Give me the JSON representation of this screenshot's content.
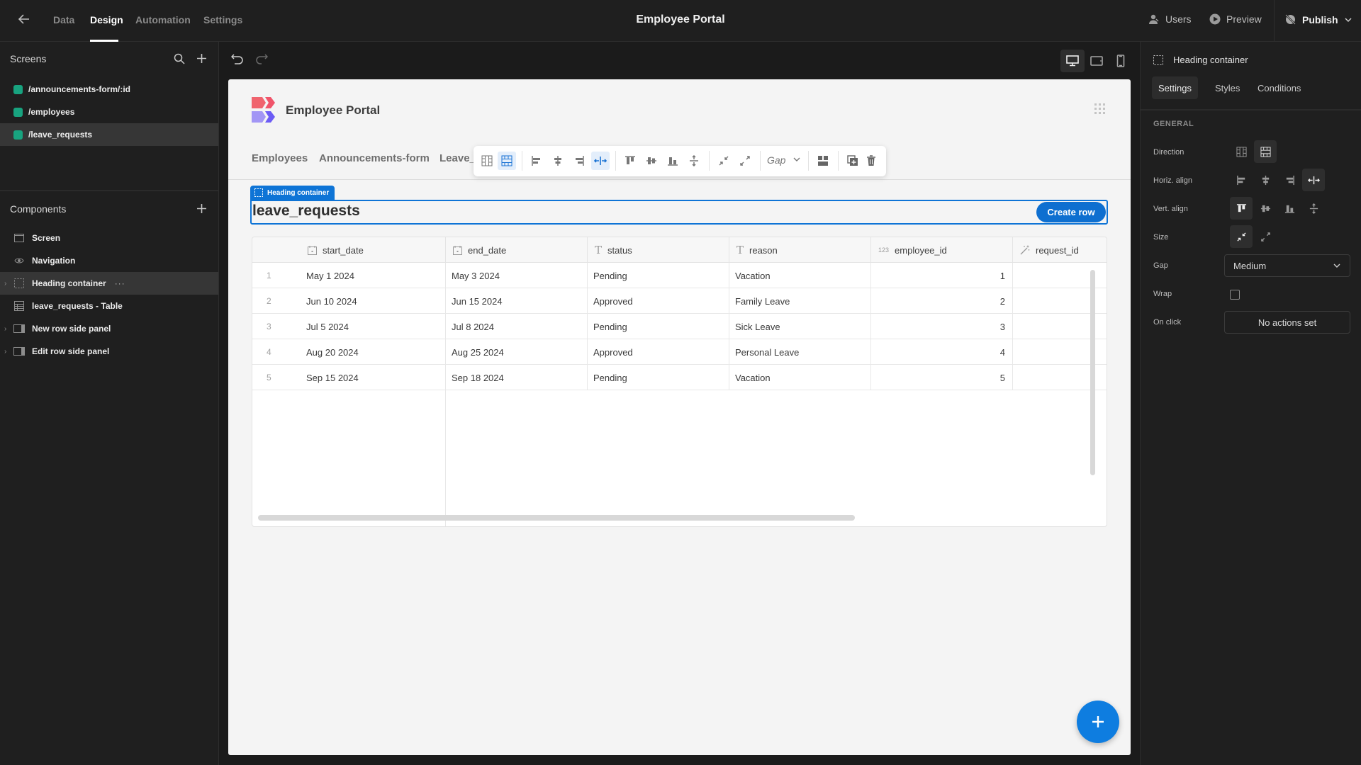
{
  "topbar": {
    "back_icon": "arrow-left-icon",
    "tabs": [
      {
        "label": "Data",
        "active": false
      },
      {
        "label": "Design",
        "active": true
      },
      {
        "label": "Automation",
        "active": false
      },
      {
        "label": "Settings",
        "active": false
      }
    ],
    "title": "Employee Portal",
    "users_label": "Users",
    "preview_label": "Preview",
    "publish_label": "Publish"
  },
  "sidebar": {
    "screens_title": "Screens",
    "screens": [
      {
        "label": "/announcements-form/:id",
        "selected": false
      },
      {
        "label": "/employees",
        "selected": false
      },
      {
        "label": "/leave_requests",
        "selected": true
      }
    ],
    "screen_color": "#18a37f",
    "components_title": "Components",
    "components": [
      {
        "label": "Screen",
        "icon": "screen-icon",
        "expandable": false,
        "selected": false
      },
      {
        "label": "Navigation",
        "icon": "eye-icon",
        "expandable": false,
        "selected": false
      },
      {
        "label": "Heading container",
        "icon": "container-icon",
        "expandable": true,
        "selected": true
      },
      {
        "label": "leave_requests - Table",
        "icon": "table-icon",
        "expandable": false,
        "selected": false
      },
      {
        "label": "New row side panel",
        "icon": "side-panel-icon",
        "expandable": true,
        "selected": false
      },
      {
        "label": "Edit row side panel",
        "icon": "side-panel-icon",
        "expandable": true,
        "selected": false
      }
    ],
    "more_label": "···"
  },
  "canvas": {
    "site_title": "Employee Portal",
    "nav_links": [
      "Employees",
      "Announcements-form",
      "Leave_"
    ],
    "floating_toolbar": {
      "gap_label": "Gap"
    },
    "heading_container_tag": "Heading container",
    "heading_title": "leave_requests",
    "create_row_label": "Create row",
    "accent_color": "#0e74d6"
  },
  "table": {
    "columns": [
      {
        "label": "start_date",
        "type_icon": "calendar-icon"
      },
      {
        "label": "end_date",
        "type_icon": "calendar-icon"
      },
      {
        "label": "status",
        "type_icon": "text-type-icon"
      },
      {
        "label": "reason",
        "type_icon": "text-type-icon"
      },
      {
        "label": "employee_id",
        "type_icon": "number-type-icon",
        "type_text": "123"
      },
      {
        "label": "request_id",
        "type_icon": "auto-id-icon"
      }
    ],
    "rows": [
      {
        "num": "1",
        "start_date": "May 1 2024",
        "end_date": "May 3 2024",
        "status": "Pending",
        "reason": "Vacation",
        "employee_id": "1",
        "request_id": ""
      },
      {
        "num": "2",
        "start_date": "Jun 10 2024",
        "end_date": "Jun 15 2024",
        "status": "Approved",
        "reason": "Family Leave",
        "employee_id": "2",
        "request_id": ""
      },
      {
        "num": "3",
        "start_date": "Jul 5 2024",
        "end_date": "Jul 8 2024",
        "status": "Pending",
        "reason": "Sick Leave",
        "employee_id": "3",
        "request_id": ""
      },
      {
        "num": "4",
        "start_date": "Aug 20 2024",
        "end_date": "Aug 25 2024",
        "status": "Approved",
        "reason": "Personal Leave",
        "employee_id": "4",
        "request_id": ""
      },
      {
        "num": "5",
        "start_date": "Sep 15 2024",
        "end_date": "Sep 18 2024",
        "status": "Pending",
        "reason": "Vacation",
        "employee_id": "5",
        "request_id": ""
      }
    ]
  },
  "props": {
    "title": "Heading container",
    "tabs": [
      {
        "label": "Settings",
        "active": true
      },
      {
        "label": "Styles",
        "active": false
      },
      {
        "label": "Conditions",
        "active": false
      }
    ],
    "section": "GENERAL",
    "direction_label": "Direction",
    "direction_value": "rows",
    "horiz_align_label": "Horiz. align",
    "horiz_align_value": "stretch",
    "vert_align_label": "Vert. align",
    "vert_align_value": "top",
    "size_label": "Size",
    "size_value": "shrink",
    "gap_label": "Gap",
    "gap_value": "Medium",
    "wrap_label": "Wrap",
    "wrap_checked": false,
    "onclick_label": "On click",
    "onclick_value": "No actions set"
  }
}
